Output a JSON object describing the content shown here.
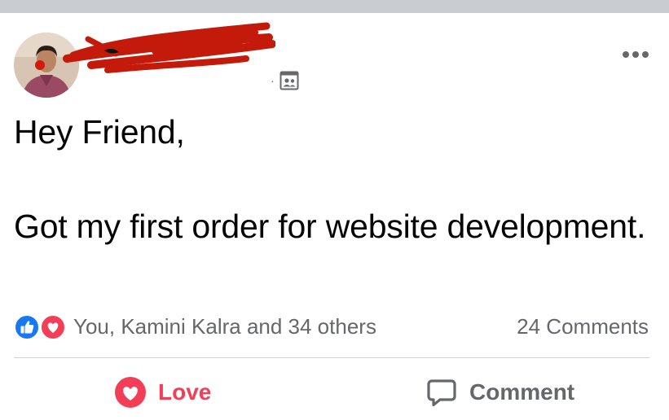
{
  "post": {
    "text": "Hey Friend,\n\nGot my first order for website development.",
    "audience_icon": "custom-audience-icon",
    "more_icon": "more-dots-icon"
  },
  "reactions": {
    "types": [
      "like",
      "love"
    ],
    "summary": "You, Kamini Kalra and 34 others"
  },
  "comments": {
    "count_label": "24 Comments"
  },
  "actions": {
    "love_label": "Love",
    "comment_label": "Comment"
  },
  "colors": {
    "like_blue": "#1877f2",
    "love_red": "#f33e58",
    "secondary_text": "#65676b",
    "divider": "#ced0d4",
    "redaction": "#c41a0b"
  }
}
